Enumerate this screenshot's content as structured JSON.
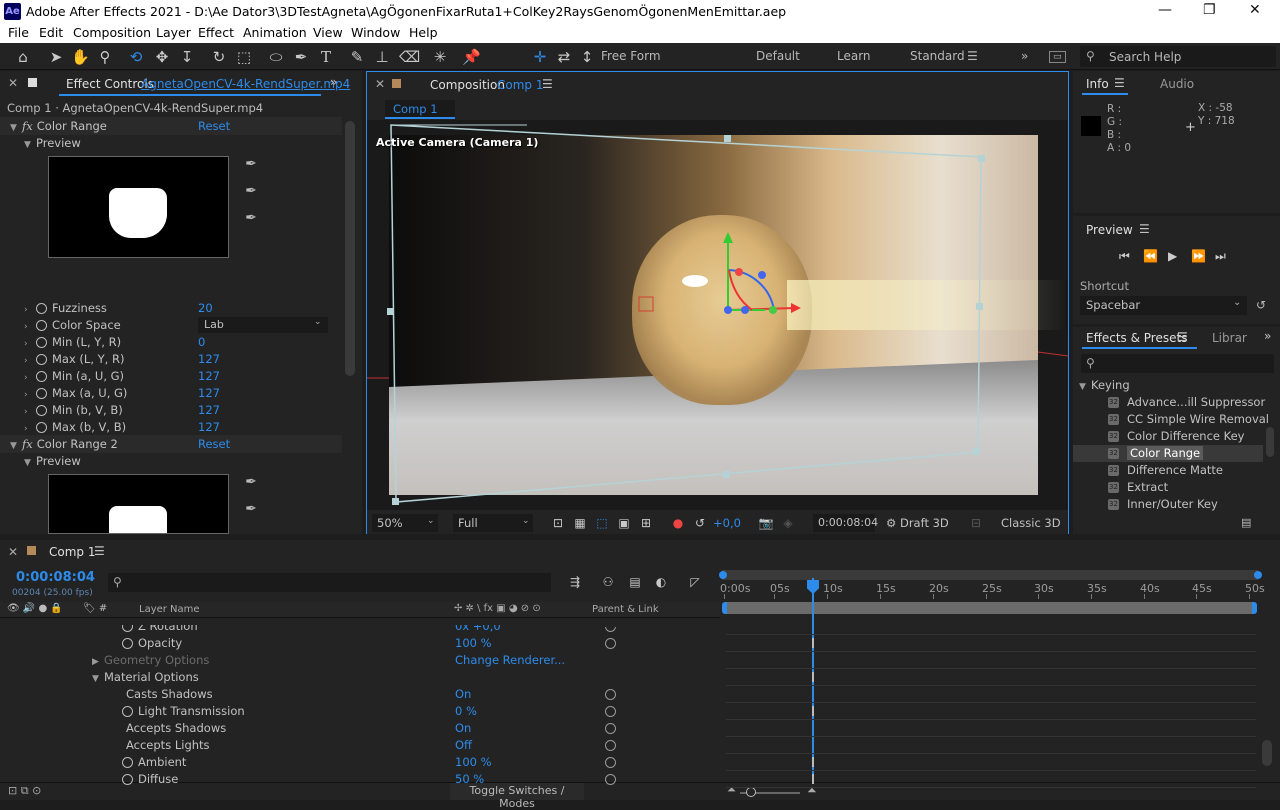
{
  "app": {
    "title": "Adobe After Effects 2021 - D:\\Ae Dator3\\3DTestAgneta\\AgÖgonenFixarRuta1+ColKey2RaysGenomÖgonenMenEmittar.aep",
    "logo": "Ae"
  },
  "menu": [
    "File",
    "Edit",
    "Composition",
    "Layer",
    "Effect",
    "Animation",
    "View",
    "Window",
    "Help"
  ],
  "toolbar": {
    "free_form": "Free Form",
    "workspaces": [
      "Default",
      "Learn",
      "Standard"
    ],
    "search_placeholder": "Search Help"
  },
  "effect_controls": {
    "tab": "Effect Controls",
    "layer": "AgnetaOpenCV-4k-RendSuper.mp4",
    "subtitle": "Comp 1 · AgnetaOpenCV-4k-RendSuper.mp4",
    "effect1": {
      "name": "Color Range",
      "reset": "Reset",
      "preview": "Preview"
    },
    "params": [
      {
        "name": "Fuzziness",
        "value": "20"
      },
      {
        "name": "Color Space",
        "value": "Lab"
      },
      {
        "name": "Min (L, Y, R)",
        "value": "0"
      },
      {
        "name": "Max (L, Y, R)",
        "value": "127"
      },
      {
        "name": "Min (a, U, G)",
        "value": "127"
      },
      {
        "name": "Max (a, U, G)",
        "value": "127"
      },
      {
        "name": "Min (b, V, B)",
        "value": "127"
      },
      {
        "name": "Max (b, V, B)",
        "value": "127"
      }
    ],
    "effect2": {
      "name": "Color Range 2",
      "reset": "Reset",
      "preview": "Preview"
    }
  },
  "composition": {
    "tab": "Composition",
    "comp": "Comp 1",
    "breadcrumb": "Comp 1",
    "camera_label": "Active Camera (Camera 1)",
    "footer": {
      "zoom": "50%",
      "resolution": "Full",
      "exposure": "+0,0",
      "timecode": "0:00:08:04",
      "draft": "Draft 3D",
      "renderer": "Classic 3D"
    }
  },
  "info": {
    "tab": "Info",
    "audio_tab": "Audio",
    "r": "R :",
    "g": "G :",
    "b": "B :",
    "a": "A :  0",
    "x": "X : -58",
    "y": "Y : 718"
  },
  "preview": {
    "title": "Preview",
    "shortcut_label": "Shortcut",
    "shortcut_value": "Spacebar"
  },
  "effects_presets": {
    "tab": "Effects & Presets",
    "libraries_tab": "Librar",
    "category": "Keying",
    "items": [
      "Advance...ill Suppressor",
      "CC Simple Wire Removal",
      "Color Difference Key",
      "Color Range",
      "Difference Matte",
      "Extract",
      "Inner/Outer Key"
    ],
    "selected": "Color Range"
  },
  "timeline": {
    "tab": "Comp 1",
    "timecode": "0:00:08:04",
    "fps": "00204 (25.00 fps)",
    "col_layer": "Layer Name",
    "col_parent": "Parent & Link",
    "ruler": [
      "0:00s",
      "05s",
      "10s",
      "15s",
      "20s",
      "25s",
      "30s",
      "35s",
      "40s",
      "45s",
      "50s"
    ],
    "rows": [
      {
        "label": "Z Rotation",
        "value": "0x +0,0°",
        "indent": 1,
        "stopwatch": true
      },
      {
        "label": "Opacity",
        "value": "100 %",
        "indent": 1,
        "stopwatch": true
      },
      {
        "label": "Geometry Options",
        "value": "Change Renderer...",
        "indent": 0,
        "tri": "▶",
        "dim": true
      },
      {
        "label": "Material Options",
        "value": "",
        "indent": 0,
        "tri": "▼"
      },
      {
        "label": "Casts Shadows",
        "value": "On",
        "indent": 2
      },
      {
        "label": "Light Transmission",
        "value": "0 %",
        "indent": 1,
        "stopwatch": true
      },
      {
        "label": "Accepts Shadows",
        "value": "On",
        "indent": 2
      },
      {
        "label": "Accepts Lights",
        "value": "Off",
        "indent": 2
      },
      {
        "label": "Ambient",
        "value": "100 %",
        "indent": 1,
        "stopwatch": true
      },
      {
        "label": "Diffuse",
        "value": "50 %",
        "indent": 1,
        "stopwatch": true
      }
    ],
    "toggle": "Toggle Switches / Modes"
  }
}
